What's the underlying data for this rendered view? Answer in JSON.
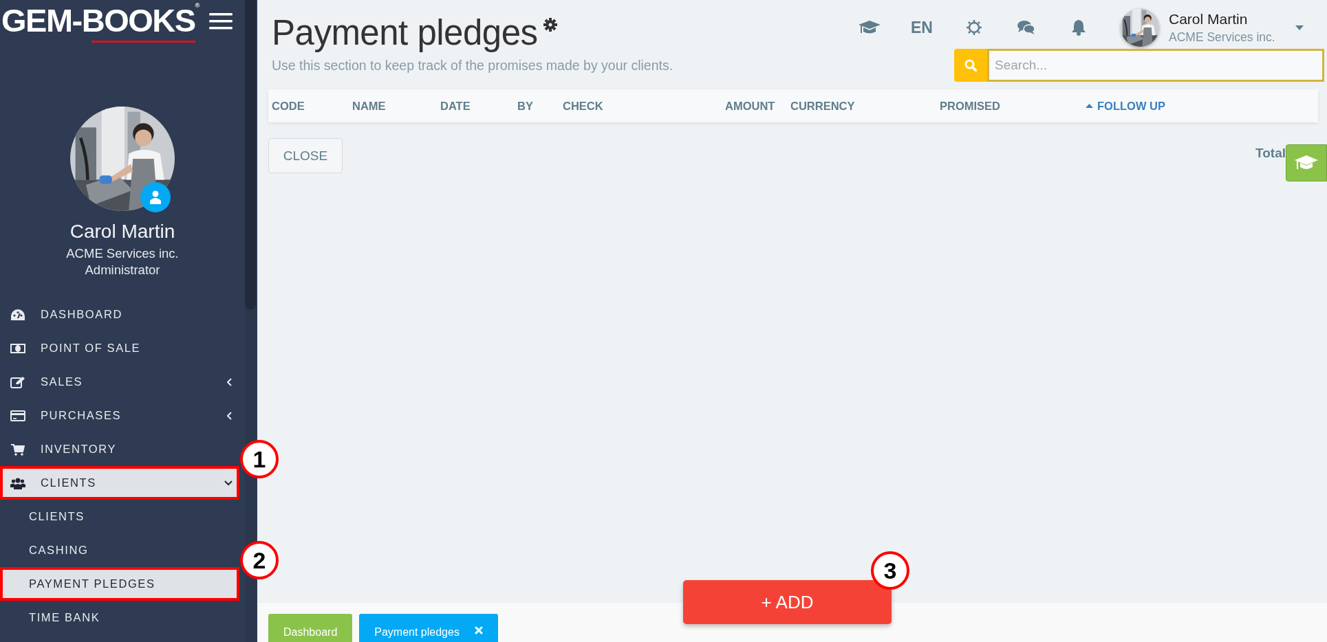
{
  "logo": {
    "text": "GEM-BOOKS",
    "mark": "®"
  },
  "profile": {
    "name": "Carol Martin",
    "company": "ACME Services inc.",
    "role": "Administrator"
  },
  "nav": [
    {
      "label": "DASHBOARD"
    },
    {
      "label": "POINT OF SALE"
    },
    {
      "label": "SALES",
      "expanded": false
    },
    {
      "label": "PURCHASES",
      "expanded": false
    },
    {
      "label": "INVENTORY"
    },
    {
      "label": "CLIENTS",
      "expanded": true,
      "callout": "1",
      "children": [
        {
          "label": "CLIENTS",
          "selected": false
        },
        {
          "label": "CASHING",
          "selected": false
        },
        {
          "label": "PAYMENT PLEDGES",
          "selected": true,
          "callout": "2"
        },
        {
          "label": "TIME BANK",
          "selected": false
        }
      ]
    }
  ],
  "header": {
    "title": "Payment pledges",
    "subtitle": "Use this section to keep track of the promises made by your clients.",
    "language": "EN",
    "user": {
      "name": "Carol Martin",
      "company": "ACME Services inc."
    }
  },
  "search": {
    "placeholder": "Search..."
  },
  "table": {
    "columns": [
      {
        "label": "CODE",
        "sorted": false
      },
      {
        "label": "NAME",
        "sorted": false
      },
      {
        "label": "DATE",
        "sorted": false
      },
      {
        "label": "BY",
        "sorted": false
      },
      {
        "label": "CHECK",
        "sorted": false
      },
      {
        "label": "AMOUNT",
        "sorted": false
      },
      {
        "label": "CURRENCY",
        "sorted": false
      },
      {
        "label": "PROMISED",
        "sorted": false
      },
      {
        "label": "FOLLOW UP",
        "sorted": true
      }
    ]
  },
  "close_button": "CLOSE",
  "total": "Total",
  "add_button": {
    "label": "+ ADD",
    "callout": "3"
  },
  "tabs": [
    {
      "label": "Dashboard",
      "color": "#8bc34a",
      "closable": false
    },
    {
      "label": "Payment pledges",
      "color": "#03a9f4",
      "closable": true
    }
  ]
}
